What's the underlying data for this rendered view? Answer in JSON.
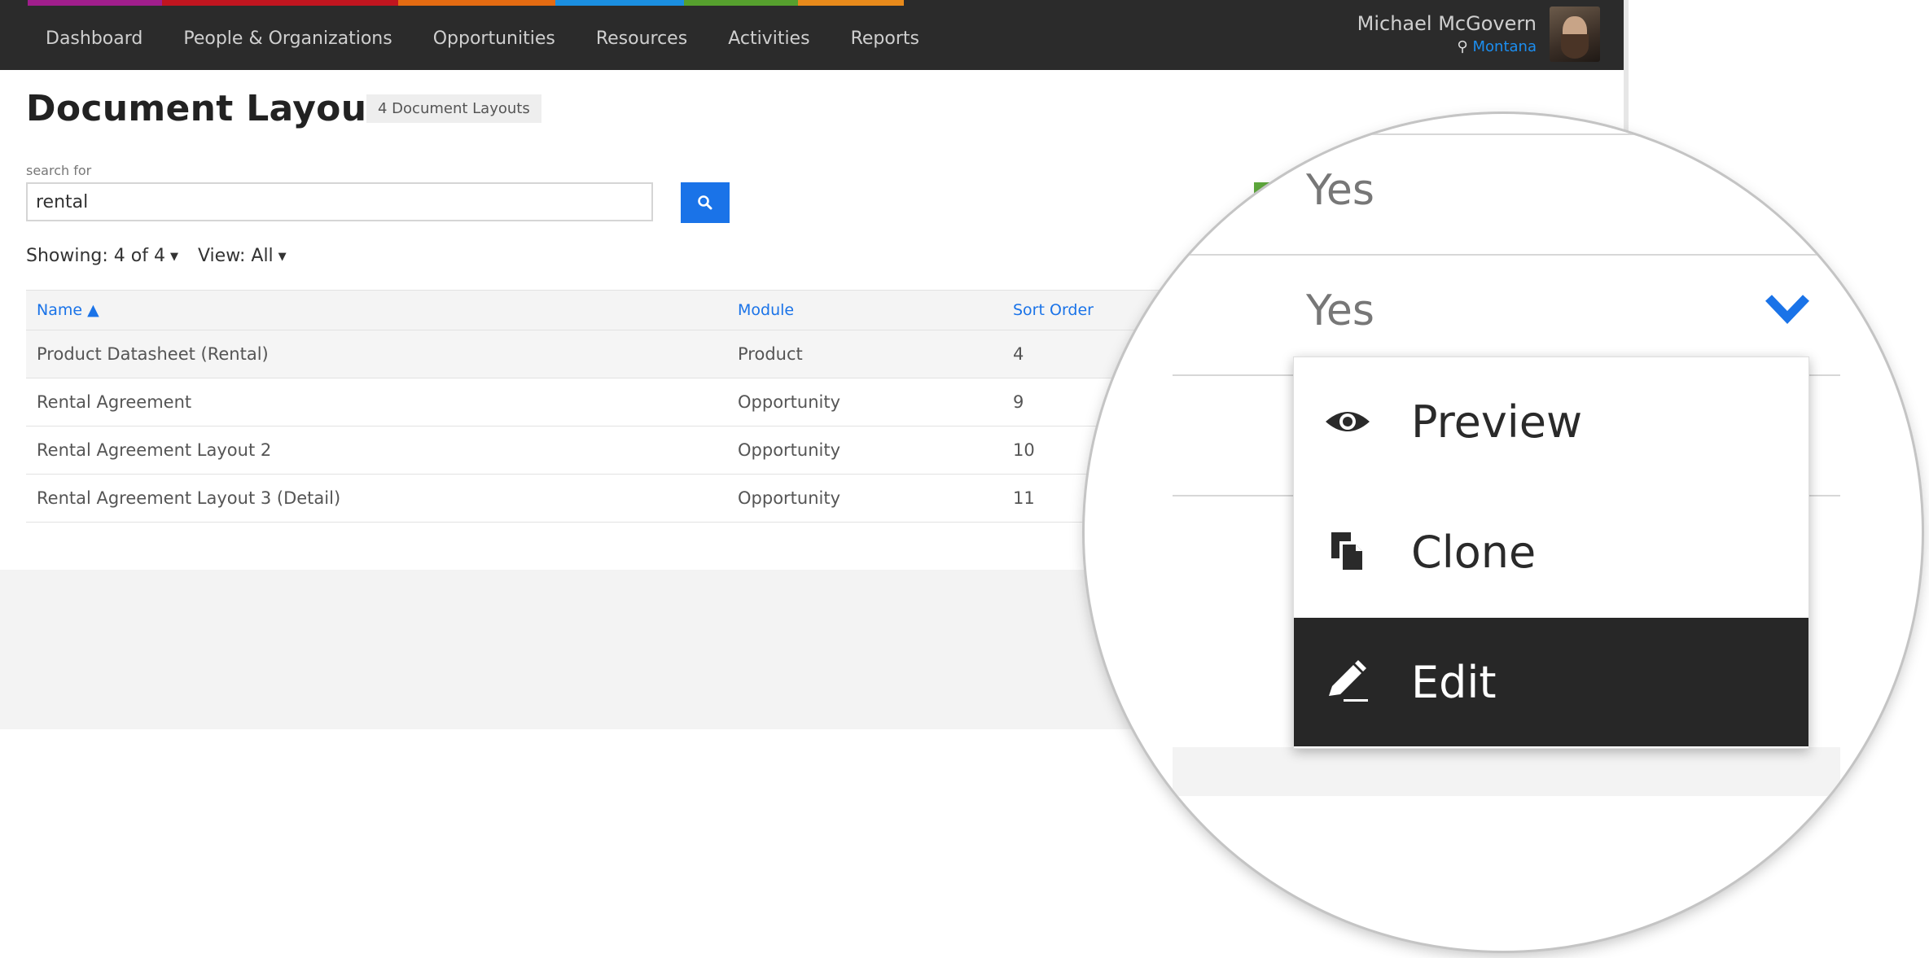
{
  "nav": {
    "items": [
      {
        "label": "Dashboard",
        "color": "#a01e8c"
      },
      {
        "label": "People & Organizations",
        "color": "#c0151f"
      },
      {
        "label": "Opportunities",
        "color": "#e36b12"
      },
      {
        "label": "Resources",
        "color": "#1b8fe0"
      },
      {
        "label": "Activities",
        "color": "#56a02e"
      },
      {
        "label": "Reports",
        "color": "#e88a1b"
      }
    ]
  },
  "user": {
    "name": "Michael McGovern",
    "location": "Montana"
  },
  "page": {
    "title": "Document Layouts",
    "count_badge": "4 Document Layouts"
  },
  "search": {
    "label": "search for",
    "value": "rental"
  },
  "filters": {
    "showing": "Showing: 4 of 4",
    "view": "View: All"
  },
  "table": {
    "columns": {
      "name": "Name ▲",
      "module": "Module",
      "sort_order": "Sort Order"
    },
    "rows": [
      {
        "name": "Product Datasheet (Rental)",
        "module": "Product",
        "sort_order": "4"
      },
      {
        "name": "Rental Agreement",
        "module": "Opportunity",
        "sort_order": "9"
      },
      {
        "name": "Rental Agreement Layout 2",
        "module": "Opportunity",
        "sort_order": "10"
      },
      {
        "name": "Rental Agreement Layout 3 (Detail)",
        "module": "Opportunity",
        "sort_order": "11"
      }
    ]
  },
  "zoom": {
    "values": [
      "Yes",
      "Yes"
    ],
    "menu": {
      "preview_label": "Preview",
      "clone_label": "Clone",
      "edit_label": "Edit"
    }
  },
  "icons": {
    "search": "search-icon",
    "preview": "eye-icon",
    "clone": "copy-icon",
    "edit": "pencil-icon",
    "toggle": "chevron-down-icon",
    "location": "map-pin-icon"
  },
  "colors": {
    "accent": "#1a73e8",
    "topbar": "#2b2b2b",
    "menu_active": "#272727"
  }
}
